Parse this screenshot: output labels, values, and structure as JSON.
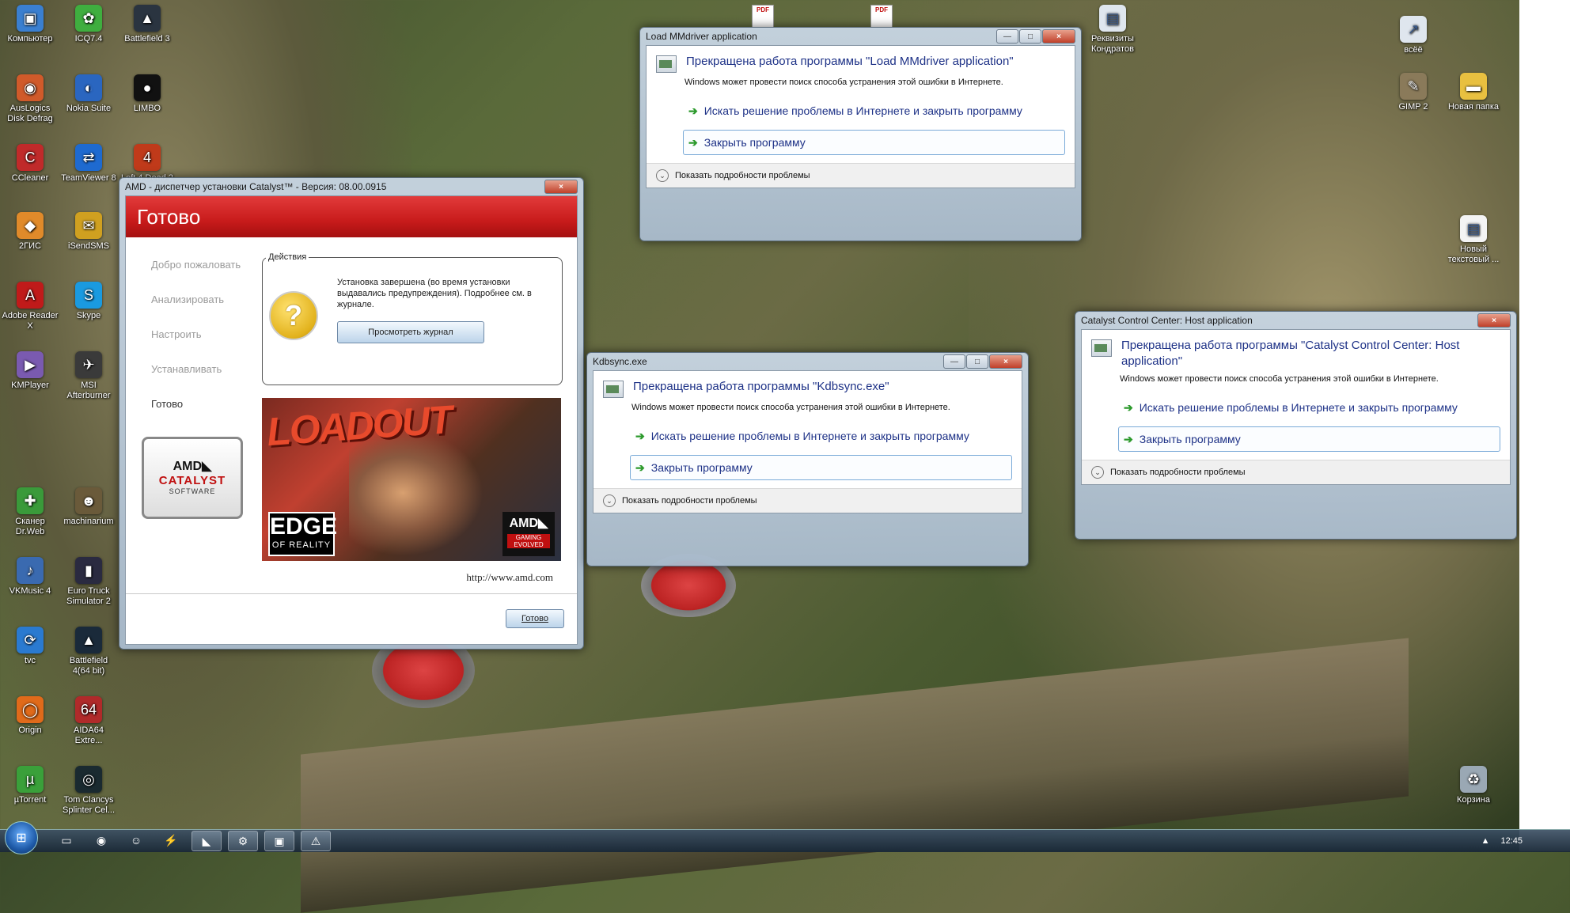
{
  "desktop": {
    "icons_left": [
      {
        "label": "Компьютер",
        "icon": "computer-icon",
        "color": "#3a7fd0",
        "glyph": "▣"
      },
      {
        "label": "ICQ7.4",
        "icon": "icq-icon",
        "color": "#3fae3f",
        "glyph": "✿"
      },
      {
        "label": "Battlefield 3",
        "icon": "battlefield-icon",
        "color": "#2a3440",
        "glyph": "▲"
      },
      {
        "label": "AusLogics Disk Defrag",
        "icon": "defrag-icon",
        "color": "#d05a2a",
        "glyph": "◉"
      },
      {
        "label": "Nokia Suite",
        "icon": "nokia-icon",
        "color": "#2a66c0",
        "glyph": "◐"
      },
      {
        "label": "LIMBO",
        "icon": "limbo-icon",
        "color": "#111111",
        "glyph": "●"
      },
      {
        "label": "CCleaner",
        "icon": "ccleaner-icon",
        "color": "#c02a2a",
        "glyph": "C"
      },
      {
        "label": "TeamViewer 8",
        "icon": "teamviewer-icon",
        "color": "#1e6ad0",
        "glyph": "⇄"
      },
      {
        "label": "Left 4 Dead 2",
        "icon": "game-icon",
        "color": "#c03a1a",
        "glyph": "4"
      },
      {
        "label": "2ГИС",
        "icon": "2gis-icon",
        "color": "#e08a2a",
        "glyph": "◆"
      },
      {
        "label": "iSendSMS",
        "icon": "isendsms-icon",
        "color": "#d0a020",
        "glyph": "✉"
      },
      {
        "label": "Adobe Reader X",
        "icon": "adobe-reader-icon",
        "color": "#c01a1a",
        "glyph": "A"
      },
      {
        "label": "Skype",
        "icon": "skype-icon",
        "color": "#1a9ae0",
        "glyph": "S"
      },
      {
        "label": "KMPlayer",
        "icon": "kmplayer-icon",
        "color": "#7a5ab0",
        "glyph": "▶"
      },
      {
        "label": "MSI Afterburner",
        "icon": "afterburner-icon",
        "color": "#3a3a3a",
        "glyph": "✈"
      },
      {
        "label": "Сканер Dr.Web",
        "icon": "drweb-icon",
        "color": "#3a9a3a",
        "glyph": "✚"
      },
      {
        "label": "machinarium",
        "icon": "machinarium-icon",
        "color": "#6a5a3a",
        "glyph": "☻"
      },
      {
        "label": "VKMusic 4",
        "icon": "vkmusic-icon",
        "color": "#3a6ab0",
        "glyph": "♪"
      },
      {
        "label": "Euro Truck Simulator 2",
        "icon": "truck-icon",
        "color": "#2a2a40",
        "glyph": "▮"
      },
      {
        "label": "tvc",
        "icon": "tvc-icon",
        "color": "#2a7ad0",
        "glyph": "⟳"
      },
      {
        "label": "Battlefield 4(64 bit)",
        "icon": "battlefield4-icon",
        "color": "#1a2a3a",
        "glyph": "▲"
      },
      {
        "label": "Origin",
        "icon": "origin-icon",
        "color": "#e06a1a",
        "glyph": "◯"
      },
      {
        "label": "AIDA64 Extre...",
        "icon": "aida64-icon",
        "color": "#b02a2a",
        "glyph": "64"
      },
      {
        "label": "µTorrent",
        "icon": "utorrent-icon",
        "color": "#3aa03a",
        "glyph": "µ"
      },
      {
        "label": "Tom Clancys Splinter Cel...",
        "icon": "splinter-cell-icon",
        "color": "#1a2a30",
        "glyph": "◎"
      }
    ],
    "icons_right": [
      {
        "label": "Реквизиты Кондратов",
        "icon": "document-icon",
        "color": "#dfe6ee",
        "glyph": "▤"
      },
      {
        "label": "всёё",
        "icon": "shortcut-icon",
        "color": "#dfe6ee",
        "glyph": "↗"
      },
      {
        "label": "GIMP 2",
        "icon": "gimp-icon",
        "color": "#8a7a5a",
        "glyph": "✎"
      },
      {
        "label": "Новая папка",
        "icon": "folder-icon",
        "color": "#e8c040",
        "glyph": "▬"
      },
      {
        "label": "Новый текстовый ...",
        "icon": "text-file-icon",
        "color": "#f4f4f4",
        "glyph": "▤"
      },
      {
        "label": "Корзина",
        "icon": "recycle-bin-icon",
        "color": "#9aa8b4",
        "glyph": "♻"
      }
    ],
    "pdf_badge": "PDF"
  },
  "amd_window": {
    "title": "AMD - диспетчер установки Catalyst™ - Версия: 08.00.0915",
    "close": "×",
    "header": "Готово",
    "steps": [
      "Добро пожаловать",
      "Анализировать",
      "Настроить",
      "Устанавливать",
      "Готово"
    ],
    "logo": {
      "line1": "AMD◣",
      "line2": "CATALYST",
      "line3": "SOFTWARE"
    },
    "actions_legend": "Действия",
    "message": "Установка завершена (во время установки выдавались предупреждения). Подробнее см. в журнале.",
    "view_log_button": "Просмотреть журнал",
    "banner": {
      "title": "LOADOUT",
      "edge_line1": "EDGE",
      "edge_line2": "OF REALITY",
      "amd_line1": "AMD◣",
      "amd_line2": "GAMING EVOLVED"
    },
    "url": "http://www.amd.com",
    "done_button": "Готово"
  },
  "err_mmdriver": {
    "title": "Load MMdriver application",
    "heading": "Прекращена работа программы \"Load MMdriver application\"",
    "desc": "Windows может провести поиск способа устранения этой ошибки в Интернете.",
    "option1": "Искать решение проблемы в Интернете и закрыть программу",
    "option2": "Закрыть программу",
    "details": "Показать подробности проблемы"
  },
  "err_kdbsync": {
    "title": "Kdbsync.exe",
    "heading": "Прекращена работа программы \"Kdbsync.exe\"",
    "desc": "Windows может провести поиск способа устранения этой ошибки в Интернете.",
    "option1": "Искать решение проблемы в Интернете и закрыть программу",
    "option2": "Закрыть программу",
    "details": "Показать подробности проблемы"
  },
  "err_ccc": {
    "title": "Catalyst Control Center: Host application",
    "heading": "Прекращена работа программы \"Catalyst Control Center: Host application\"",
    "desc": "Windows может провести поиск способа устранения этой ошибки в Интернете.",
    "option1": "Искать решение проблемы в Интернете и закрыть программу",
    "option2": "Закрыть программу",
    "details": "Показать подробности проблемы"
  },
  "window_buttons": {
    "min": "—",
    "max": "□",
    "close": "×",
    "expand": "⌄",
    "arrow": "➔"
  },
  "taskbar": {
    "start_glyph": "⊞",
    "items": [
      {
        "icon": "explorer-icon",
        "glyph": "▭",
        "open": false
      },
      {
        "icon": "chrome-icon",
        "glyph": "◉",
        "open": false
      },
      {
        "icon": "skype-taskbar-icon",
        "glyph": "☺",
        "open": false
      },
      {
        "icon": "tools-icon",
        "glyph": "⚡",
        "open": false
      },
      {
        "icon": "amd-taskbar-icon",
        "glyph": "◣",
        "open": true
      },
      {
        "icon": "installer-taskbar-icon",
        "glyph": "⚙",
        "open": true
      },
      {
        "icon": "app-taskbar-icon",
        "glyph": "▣",
        "open": true
      },
      {
        "icon": "error-taskbar-icon",
        "glyph": "⚠",
        "open": true
      }
    ],
    "tray_glyph": "▲",
    "time": "12:45"
  }
}
